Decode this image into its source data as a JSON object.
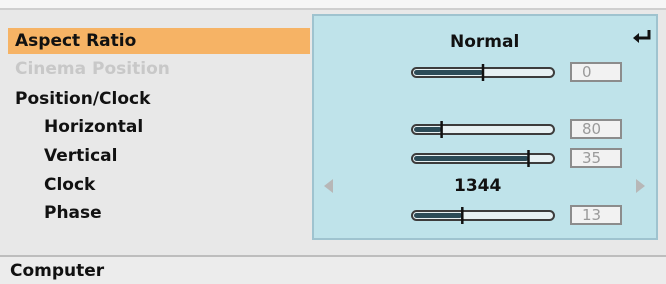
{
  "menu": {
    "items": [
      {
        "label": "Aspect Ratio"
      },
      {
        "label": "Cinema Position"
      },
      {
        "label": "Position/Clock"
      },
      {
        "label": "Horizontal"
      },
      {
        "label": "Vertical"
      },
      {
        "label": "Clock"
      },
      {
        "label": "Phase"
      }
    ]
  },
  "settings": {
    "aspect_ratio": "Normal",
    "cinema_position": {
      "value": "0",
      "level": 0.5
    },
    "horizontal": {
      "value": "80",
      "level": 0.2
    },
    "vertical": {
      "value": "35",
      "level": 0.83
    },
    "clock": "1344",
    "phase": {
      "value": "13",
      "level": 0.35
    }
  },
  "status": {
    "source": "Computer"
  },
  "colors": {
    "highlight": "#f6b365",
    "panel": "#bfe3ea",
    "disabled_text": "#c8c8c8"
  },
  "icons": {
    "enter": "enter-arrow-icon",
    "left": "left-arrow-icon",
    "right": "right-arrow-icon"
  }
}
